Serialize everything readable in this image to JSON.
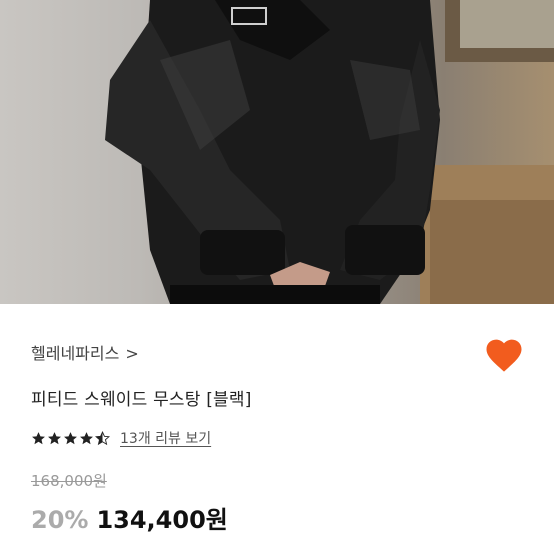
{
  "product": {
    "brand": "헬레네파리스",
    "brand_chevron": ">",
    "title": "피티드 스웨이드 무스탕 [블랙]",
    "rating": 4.5,
    "reviews_label": "13개 리뷰 보기",
    "original_price": "168,000원",
    "discount": "20%",
    "price": "134,400원"
  },
  "colors": {
    "heart": "#f25c1e",
    "star": "#222222",
    "discount": "#ababab"
  },
  "icons": {
    "wishlist": "heart-icon",
    "rating": "star-icon"
  }
}
